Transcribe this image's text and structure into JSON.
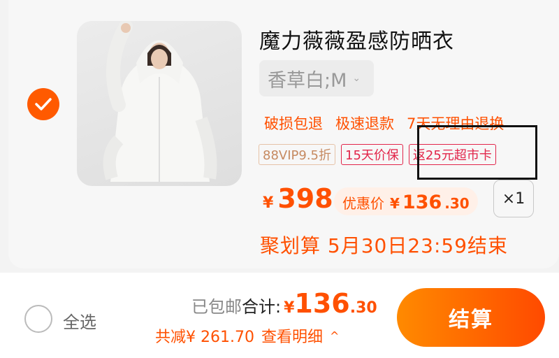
{
  "item": {
    "checked": true,
    "title": "魔力薇薇盈感防晒衣",
    "sku": "香草白;M",
    "services": [
      "破损包退",
      "极速退款",
      "7天无理由退换"
    ],
    "tags": [
      {
        "text": "88VIP9.5折",
        "style": "vip"
      },
      {
        "text": "15天价保",
        "style": "red"
      },
      {
        "text": "返25元超市卡",
        "style": "red"
      }
    ],
    "price": {
      "symbol": "¥",
      "value": "398"
    },
    "promo": {
      "label": "优惠价",
      "symbol": "¥",
      "int": "136",
      "dec": ".30"
    },
    "quantity": "×1",
    "deal_text": "聚划算 5月30日23:59结束"
  },
  "footer": {
    "select_all": "全选",
    "shipping": "已包邮",
    "total_label": "合计:",
    "total_symbol": "¥",
    "total_int": "136",
    "total_dec": ".30",
    "savings": "共减¥ 261.70",
    "details": "查看明细",
    "checkout": "结算"
  },
  "colors": {
    "accent": "#ff5000",
    "tag_red": "#e2254a",
    "vip": "#c68a61"
  }
}
